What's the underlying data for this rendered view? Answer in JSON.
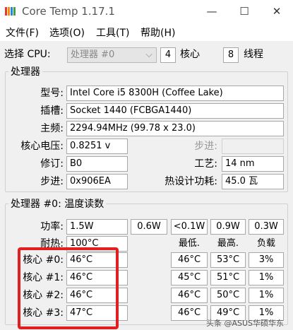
{
  "window": {
    "title": "Core Temp 1.17.1"
  },
  "menu": [
    "文件(F)",
    "选项(O)",
    "工具(T)",
    "帮助(H)"
  ],
  "select_cpu": {
    "label": "选择 CPU:",
    "value": "处理器 #0",
    "cores_value": "4",
    "cores_label": "核心",
    "threads_value": "8",
    "threads_label": "线程"
  },
  "processor": {
    "group_title": "处理器",
    "model_label": "型号:",
    "model_value": "Intel Core i5 8300H (Coffee Lake)",
    "socket_label": "插槽:",
    "socket_value": "Socket 1440 (FCBGA1440)",
    "freq_label": "主频:",
    "freq_value": "2294.94MHz (99.78 x 23.0)",
    "vcore_label": "核心电压:",
    "vcore_value": "0.8251 v",
    "stepping_label_top": "步进:",
    "stepping_value_top": "",
    "revision_label": "修订:",
    "revision_value": "B0",
    "lithography_label": "工艺:",
    "lithography_value": "14 nm",
    "cpuid_label": "步进:",
    "cpuid_value": "0x906EA",
    "tdp_label": "热设计功耗:",
    "tdp_value": "45.0 瓦"
  },
  "temps": {
    "group_title": "处理器 #0: 温度读数",
    "power_label": "功率:",
    "power_values": [
      "1.5W",
      "0.6W",
      "<0.1W",
      "0.9W",
      "0.3W"
    ],
    "tj_label": "耐热:",
    "tj_value": "100°C",
    "headers": {
      "min": "最低.",
      "max": "最高.",
      "load": "负载"
    },
    "cores": [
      {
        "label": "核心 #0:",
        "temp": "46°C",
        "min": "46°C",
        "max": "53°C",
        "load": "3%"
      },
      {
        "label": "核心 #1:",
        "temp": "46°C",
        "min": "45°C",
        "max": "51°C",
        "load": "1%"
      },
      {
        "label": "核心 #2:",
        "temp": "46°C",
        "min": "46°C",
        "max": "50°C",
        "load": "1%"
      },
      {
        "label": "核心 #3:",
        "temp": "47°C",
        "min": "46°C",
        "max": "49°C",
        "load": "1%"
      }
    ]
  },
  "watermark": "头条 @ASUS华硕华东"
}
